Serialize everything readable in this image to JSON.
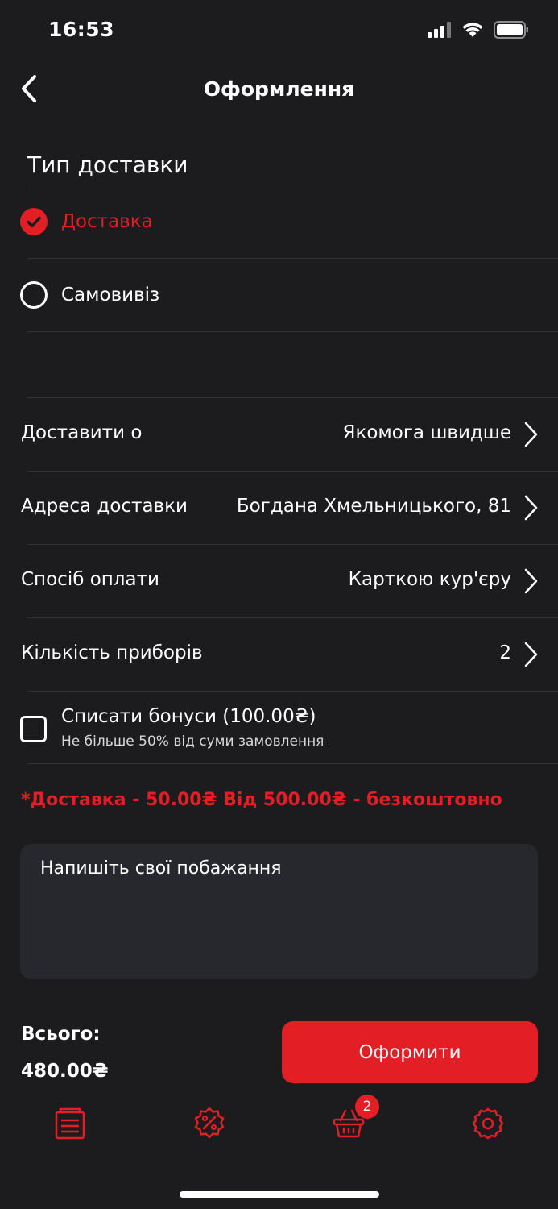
{
  "status_bar": {
    "time": "16:53"
  },
  "nav": {
    "title": "Оформлення"
  },
  "delivery_type": {
    "title": "Тип доставки",
    "options": [
      {
        "label": "Доставка",
        "selected": true
      },
      {
        "label": "Самовивіз",
        "selected": false
      }
    ]
  },
  "details": [
    {
      "label": "Доставити о",
      "value": "Якомога швидше"
    },
    {
      "label": "Адреса доставки",
      "value": "Богдана Хмельницького, 81"
    },
    {
      "label": "Спосіб оплати",
      "value": "Карткою кур'єру"
    },
    {
      "label": "Кількість приборів",
      "value": "2"
    }
  ],
  "bonuses": {
    "label": "Списати бонуси (100.00₴)",
    "sublabel": "Не більше 50% від суми замовлення",
    "checked": false
  },
  "delivery_note": "*Доставка - 50.00₴ Від 500.00₴ - безкоштовно",
  "wishes": {
    "placeholder": "Напишіть свої побажання"
  },
  "summary": {
    "total_label": "Всього:",
    "total_value": "480.00₴"
  },
  "checkout": {
    "label": "Оформити"
  },
  "tab_bar": {
    "items": [
      {
        "icon": "menu-icon"
      },
      {
        "icon": "discount-icon"
      },
      {
        "icon": "cart-icon",
        "badge": "2"
      },
      {
        "icon": "settings-icon"
      }
    ]
  },
  "colors": {
    "accent": "#e31e24",
    "background": "#1c1c1e",
    "input_bg": "#26282d",
    "divider": "#333336"
  }
}
